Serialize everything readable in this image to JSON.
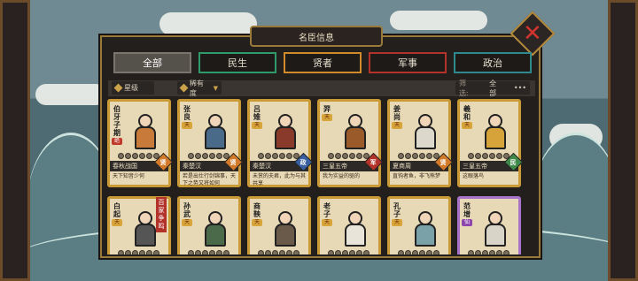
{
  "title": "名臣信息",
  "tabs": [
    {
      "label": "全部",
      "active": true,
      "color": "#7a766e"
    },
    {
      "label": "民生",
      "active": false,
      "color": "#2f9a6a"
    },
    {
      "label": "贤者",
      "active": false,
      "color": "#d18a2a"
    },
    {
      "label": "军事",
      "active": false,
      "color": "#b3332b"
    },
    {
      "label": "政治",
      "active": false,
      "color": "#2f8a8f"
    }
  ],
  "filters": {
    "star": "星级",
    "rarity": "稀有度",
    "screen_label": "筛选:",
    "screen_value": "全部",
    "more": "•••"
  },
  "cards": [
    {
      "name": "伯牙子期",
      "rarity": "绝",
      "rarity_style": "red",
      "faction": "春秋战国",
      "badge": "贤",
      "badge_color": "bg-orange",
      "desc": "天下知音少何",
      "robe": "#c77a3a",
      "frame": "gold"
    },
    {
      "name": "张良",
      "rarity": "天",
      "rarity_style": "gold",
      "faction": "秦楚汉",
      "badge": "贤",
      "badge_color": "bg-orange",
      "desc": "若是出仕行剑锦事，天下之势又将如何",
      "robe": "#4a6a8a",
      "frame": "gold"
    },
    {
      "name": "吕雉",
      "rarity": "天",
      "rarity_style": "gold",
      "faction": "秦楚汉",
      "badge": "政",
      "badge_color": "bg-blue",
      "desc": "未赏的夫君，此为与其共享",
      "robe": "#8a3a2a",
      "frame": "gold"
    },
    {
      "name": "羿",
      "rarity": "天",
      "rarity_style": "gold",
      "faction": "三皇五帝",
      "badge": "军",
      "badge_color": "bg-red",
      "desc": "我为实益的驱的",
      "robe": "#9a5a2a",
      "frame": "gold"
    },
    {
      "name": "姜尚",
      "rarity": "天",
      "rarity_style": "gold",
      "faction": "夏商周",
      "badge": "贤",
      "badge_color": "bg-orange",
      "desc": "直钩者鱼，非飞熊梦",
      "robe": "#ddd8cc",
      "frame": "gold"
    },
    {
      "name": "羲和",
      "rarity": "天",
      "rarity_style": "gold",
      "faction": "三皇五帝",
      "badge": "民",
      "badge_color": "bg-green",
      "desc": "这眼落鸟",
      "robe": "#d6a23a",
      "frame": "gold"
    },
    {
      "name": "白起",
      "rarity": "天",
      "rarity_style": "gold",
      "faction": "",
      "badge": "",
      "badge_color": "",
      "desc": "",
      "robe": "#555",
      "frame": "gold"
    },
    {
      "name": "孙武",
      "rarity": "天",
      "rarity_style": "gold",
      "faction": "",
      "badge": "",
      "badge_color": "",
      "desc": "",
      "robe": "#4a6a4a",
      "frame": "gold"
    },
    {
      "name": "商鞅",
      "rarity": "天",
      "rarity_style": "gold",
      "faction": "",
      "badge": "",
      "badge_color": "",
      "desc": "",
      "robe": "#6a5a4a",
      "frame": "gold"
    },
    {
      "name": "老子",
      "rarity": "天",
      "rarity_style": "gold",
      "faction": "",
      "badge": "",
      "badge_color": "",
      "desc": "",
      "robe": "#e8e4da",
      "frame": "gold"
    },
    {
      "name": "孔子",
      "rarity": "天",
      "rarity_style": "gold",
      "faction": "",
      "badge": "",
      "badge_color": "",
      "desc": "",
      "robe": "#7aa0a8",
      "frame": "gold"
    },
    {
      "name": "范增",
      "rarity": "仙",
      "rarity_style": "pur",
      "faction": "",
      "badge": "",
      "badge_color": "",
      "desc": "",
      "robe": "#d8d4c8",
      "frame": "purple"
    }
  ],
  "side_label": "百家争鸣"
}
